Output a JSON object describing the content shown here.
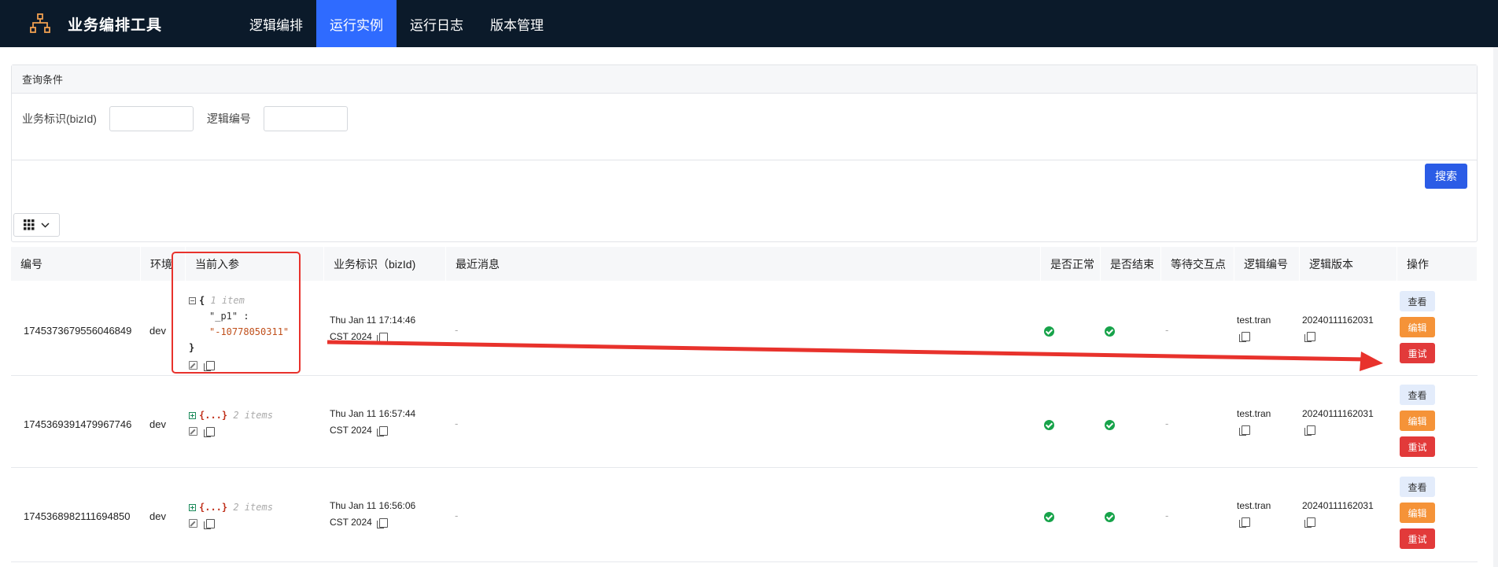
{
  "app": {
    "title": "业务编排工具",
    "logo_icon": "org-chart-icon"
  },
  "nav": {
    "items": [
      {
        "label": "逻辑编排",
        "active": false
      },
      {
        "label": "运行实例",
        "active": true
      },
      {
        "label": "运行日志",
        "active": false
      },
      {
        "label": "版本管理",
        "active": false
      }
    ]
  },
  "query": {
    "title": "查询条件",
    "bizid_label": "业务标识(bizId)",
    "bizid_value": "",
    "logic_label": "逻辑编号",
    "logic_value": "",
    "search_label": "搜索"
  },
  "table": {
    "headers": [
      "编号",
      "环境",
      "当前入参",
      "业务标识（bizId)",
      "最近消息",
      "是否正常",
      "是否结束",
      "等待交互点",
      "逻辑编号",
      "逻辑版本",
      "操作"
    ],
    "rows": [
      {
        "id": "1745373679556046849",
        "env": "dev",
        "params_expanded": true,
        "params_count": "1 item",
        "param_key": "\"_p1\"",
        "param_value": "\"-10778050311\"",
        "biz_line1": "Thu Jan 11 17:14:46",
        "biz_line2": "CST 2024",
        "last_msg": "-",
        "waiting": "-",
        "logic_no": "test.tran",
        "logic_ver": "20240111162031"
      },
      {
        "id": "1745369391479967746",
        "env": "dev",
        "params_expanded": false,
        "params_count": "2 items",
        "biz_line1": "Thu Jan 11 16:57:44",
        "biz_line2": "CST 2024",
        "last_msg": "-",
        "waiting": "-",
        "logic_no": "test.tran",
        "logic_ver": "20240111162031"
      },
      {
        "id": "1745368982111694850",
        "env": "dev",
        "params_expanded": false,
        "params_count": "2 items",
        "biz_line1": "Thu Jan 11 16:56:06",
        "biz_line2": "CST 2024",
        "last_msg": "-",
        "waiting": "-",
        "logic_no": "test.tran",
        "logic_ver": "20240111162031"
      }
    ],
    "actions": {
      "view": "查看",
      "edit": "编辑",
      "retry": "重试"
    }
  },
  "json_syntax": {
    "open_brace": "{",
    "close_brace": "}",
    "colon": ":",
    "collapsed": "{...}"
  },
  "colors": {
    "nav_bg": "#0b1a2a",
    "nav_active": "#2f6bff",
    "search_btn": "#2b5ce6",
    "ok_green": "#17a34a",
    "edit_orange": "#f59338",
    "retry_red": "#e23a3a",
    "annotation_red": "#e8322c"
  }
}
